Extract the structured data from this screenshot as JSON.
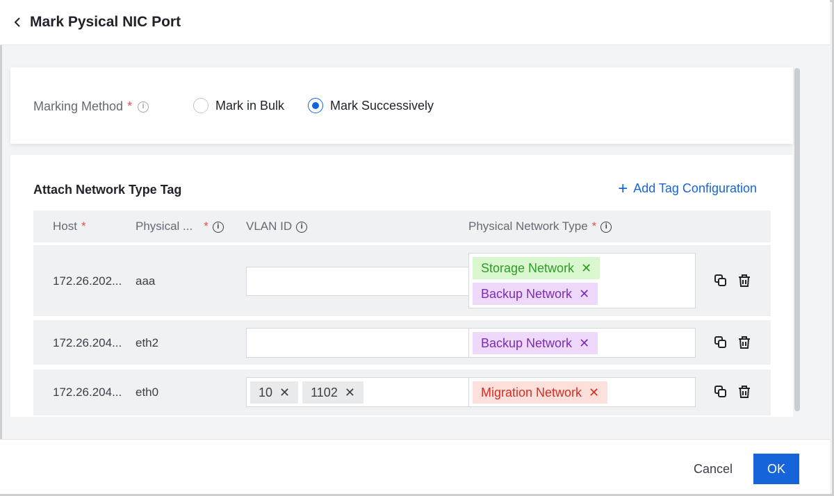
{
  "header": {
    "title": "Mark Pysical NIC Port"
  },
  "marking": {
    "label": "Marking Method",
    "required_mark": "*",
    "options": [
      {
        "label": "Mark in Bulk",
        "selected": false
      },
      {
        "label": "Mark Successively",
        "selected": true
      }
    ]
  },
  "section": {
    "title": "Attach Network Type Tag",
    "add_label": "Add Tag Configuration"
  },
  "table": {
    "columns": {
      "host": "Host",
      "port": "Physical ...",
      "vlan": "VLAN ID",
      "type": "Physical Network Type"
    },
    "rows": [
      {
        "host": "172.26.202...",
        "port": "aaa",
        "vlan_tags": [],
        "type_tags": [
          "Storage Network",
          "Backup Network"
        ]
      },
      {
        "host": "172.26.204...",
        "port": "eth2",
        "vlan_tags": [],
        "type_tags": [
          "Backup Network"
        ]
      },
      {
        "host": "172.26.204...",
        "port": "eth0",
        "vlan_tags": [
          "10",
          "1102"
        ],
        "type_tags": [
          "Migration Network"
        ]
      }
    ]
  },
  "icons": {
    "back": "chevron-left-icon",
    "info": "info-icon",
    "add": "plus-icon",
    "copy": "copy-icon",
    "delete": "trash-icon",
    "remove": "close-icon"
  },
  "colors": {
    "primary": "#1664d9",
    "required": "#e34d59",
    "storage_tag_bg": "#d9f8cf",
    "storage_tag_fg": "#2e9a28",
    "backup_tag_bg": "#efd9fb",
    "backup_tag_fg": "#7a2bb8",
    "migration_tag_bg": "#fde0dc",
    "migration_tag_fg": "#d92d20"
  },
  "footer": {
    "cancel_label": "Cancel",
    "ok_label": "OK"
  }
}
